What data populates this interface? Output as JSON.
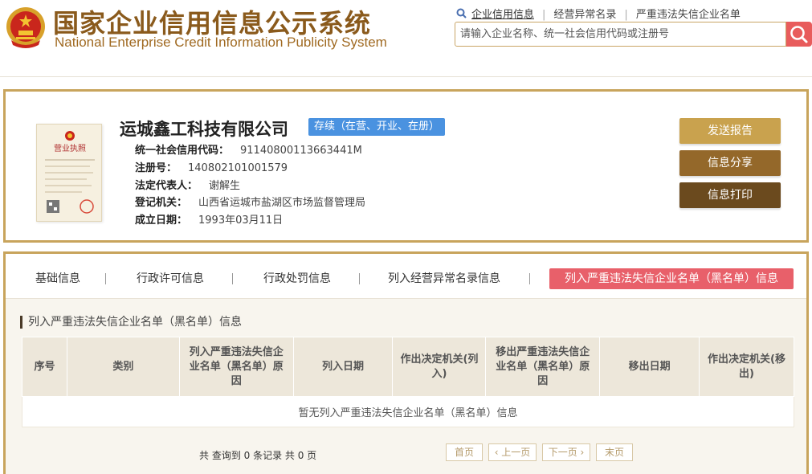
{
  "header": {
    "title": "国家企业信用信息公示系统",
    "subtitle": "National Enterprise Credit Information Publicity System",
    "links": [
      "企业信用信息",
      "经营异常名录",
      "严重违法失信企业名单"
    ],
    "search_placeholder": "请输入企业名称、统一社会信用代码或注册号"
  },
  "company": {
    "name": "运城鑫工科技有限公司",
    "status": "存续（在营、开业、在册）",
    "fields": [
      {
        "label": "统一社会信用代码：",
        "value": "91140800113663441M"
      },
      {
        "label": "注册号：",
        "value": "140802101001579"
      },
      {
        "label": "法定代表人：",
        "value": "谢解生"
      },
      {
        "label": "登记机关：",
        "value": "山西省运城市盐湖区市场监督管理局"
      },
      {
        "label": "成立日期：",
        "value": "1993年03月11日"
      }
    ],
    "actions": [
      "发送报告",
      "信息分享",
      "信息打印"
    ],
    "license_text": "营业执照"
  },
  "tabs": [
    "基础信息",
    "行政许可信息",
    "行政处罚信息",
    "列入经营异常名录信息",
    "列入严重违法失信企业名单（黑名单）信息"
  ],
  "section": {
    "title": "列入严重违法失信企业名单（黑名单）信息",
    "columns": [
      "序号",
      "类别",
      "列入严重违法失信企业名单（黑名单）原因",
      "列入日期",
      "作出决定机关(列入)",
      "移出严重违法失信企业名单（黑名单）原因",
      "移出日期",
      "作出决定机关(移出)"
    ],
    "empty_text": "暂无列入严重违法失信企业名单（黑名单）信息"
  },
  "pagination": {
    "info": "共 查询到 0 条记录 共 0 页",
    "first": "首页",
    "prev": "‹ 上一页",
    "next": "下一页 ›",
    "last": "末页"
  },
  "colors": {
    "brand": "#8a5a1c",
    "panel_border": "#c8a45c",
    "active_tab": "#e8606a",
    "status_badge": "#4a92e0",
    "btn_send": "#c9a24e",
    "btn_share": "#94682a",
    "btn_print": "#6b4a1e"
  }
}
